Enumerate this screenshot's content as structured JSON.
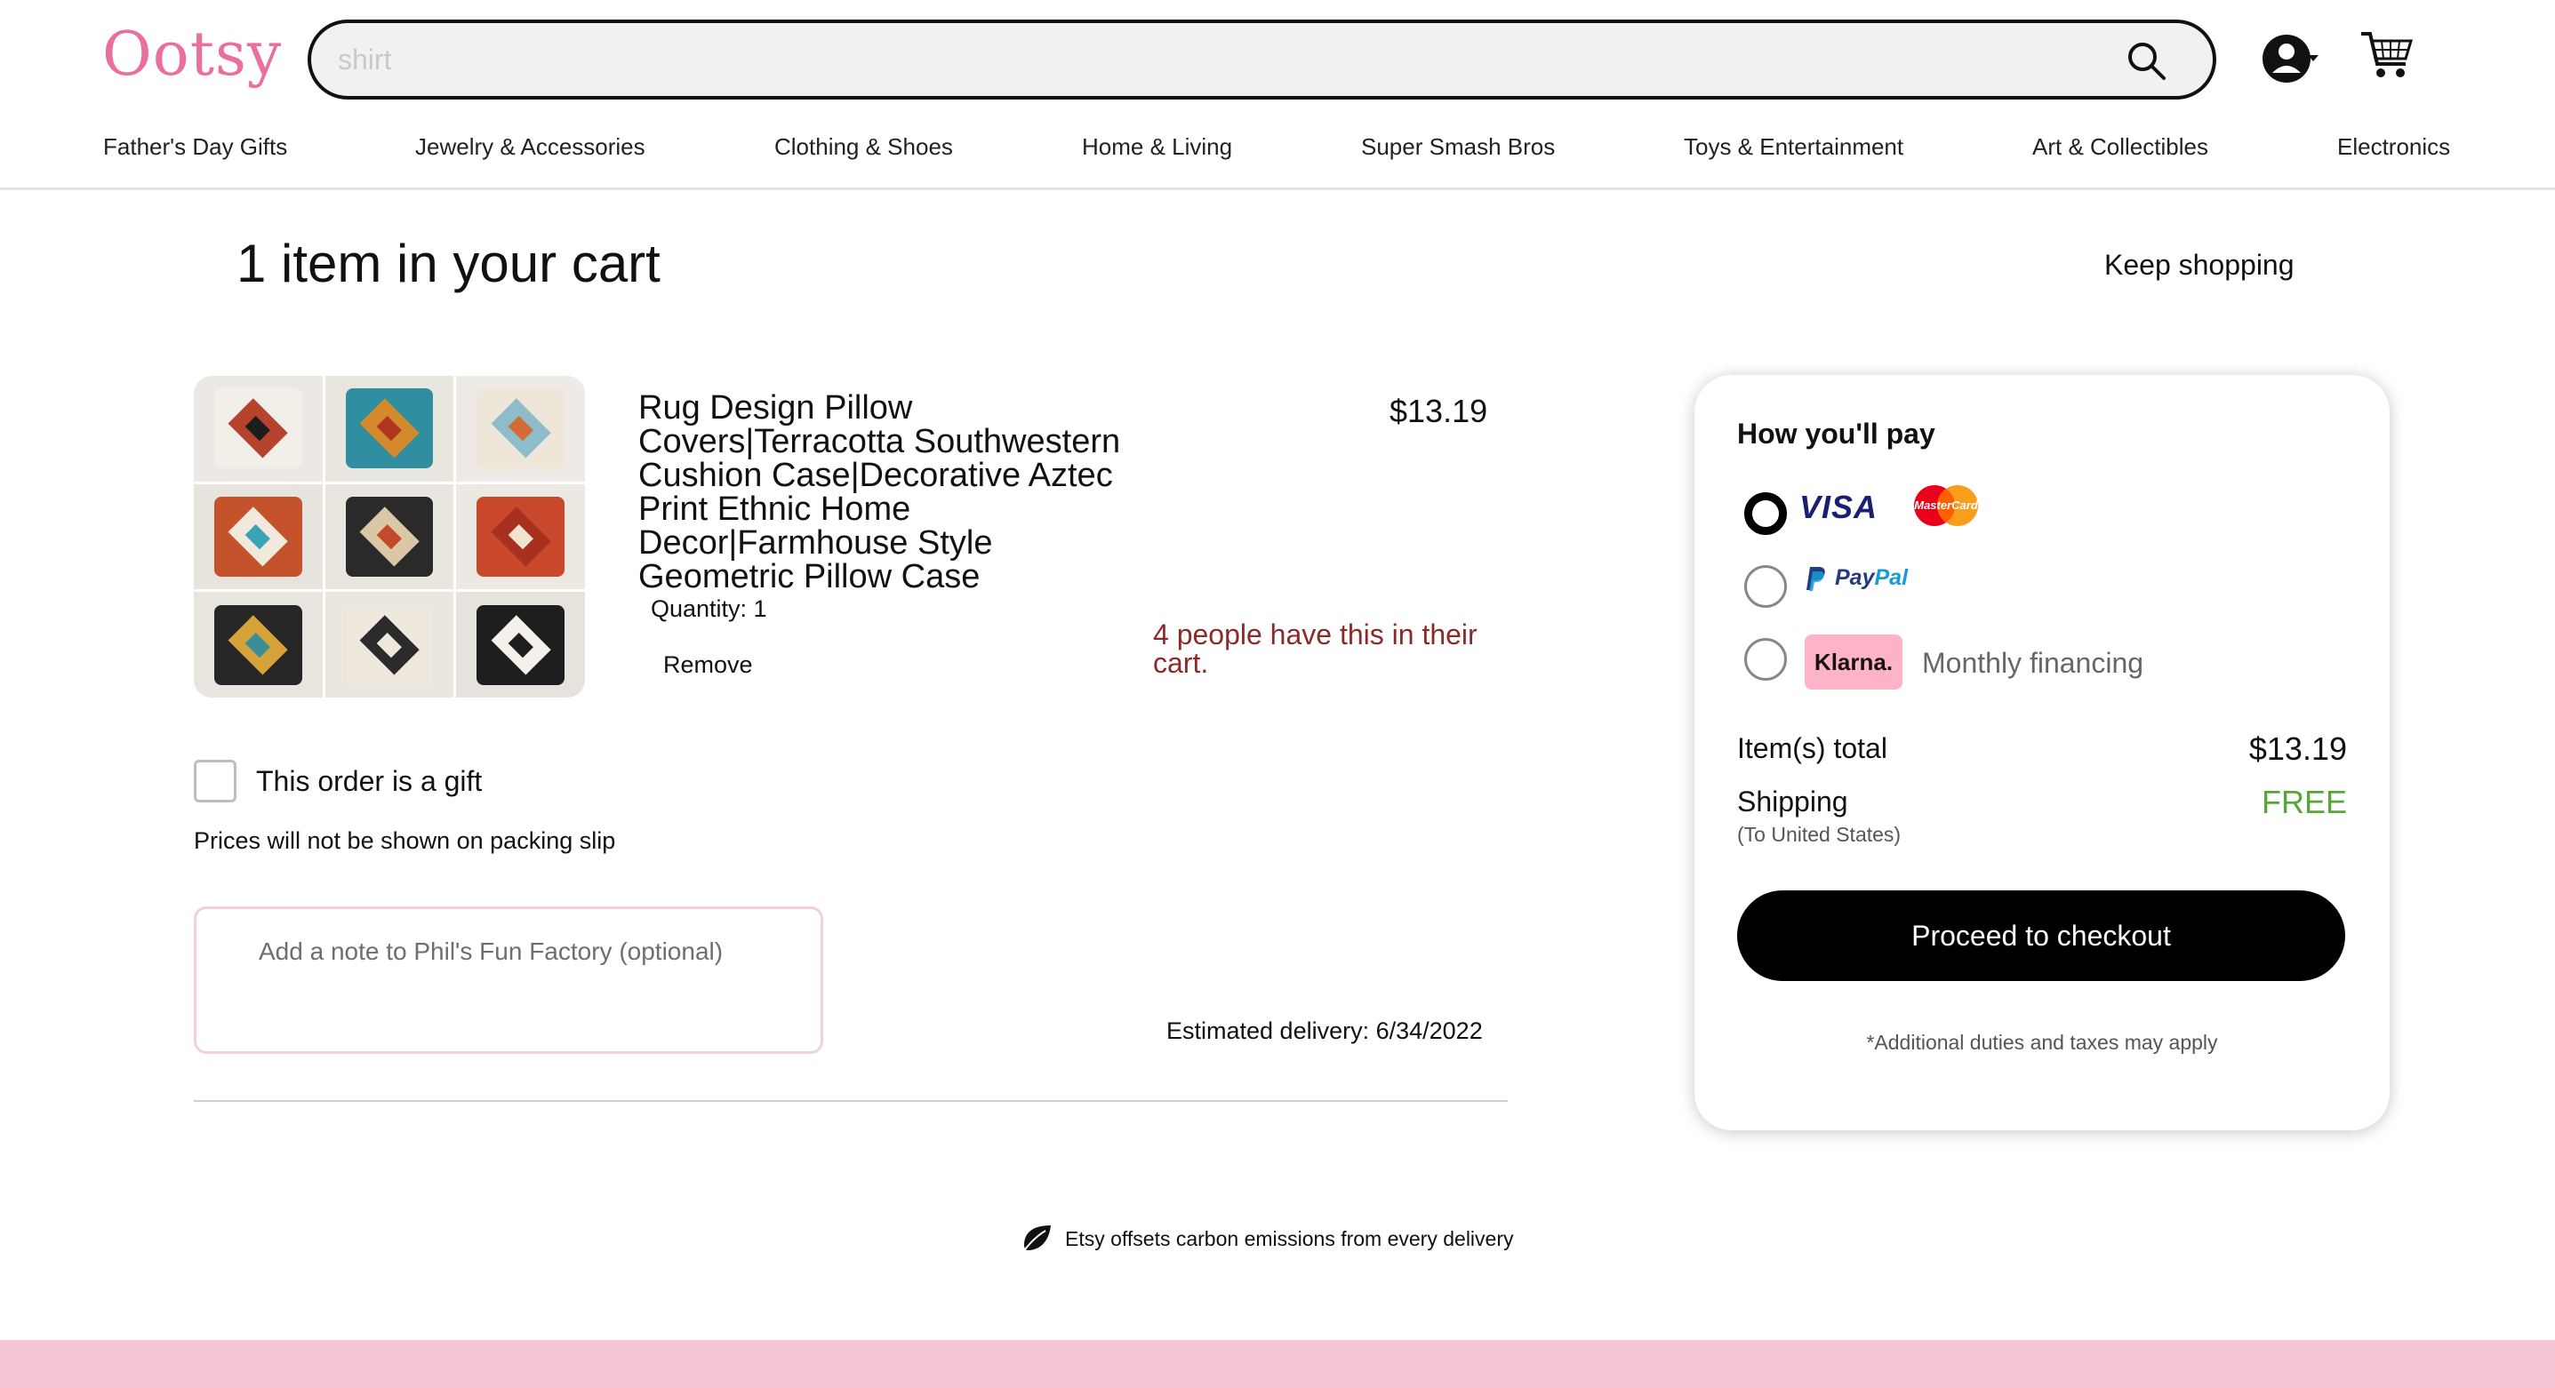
{
  "header": {
    "logo": "Ootsy",
    "search_value": "shirt",
    "nav": [
      "Father's Day Gifts",
      "Jewelry & Accessories",
      "Clothing & Shoes",
      "Home & Living",
      "Super Smash Bros",
      "Toys & Entertainment",
      "Art & Collectibles",
      "Electronics"
    ]
  },
  "cart": {
    "title": "1 item in your cart",
    "keep_shopping": "Keep shopping",
    "item": {
      "title": "Rug Design Pillow Covers|Terracotta Southwestern Cushion Case|Decorative Aztec Print Ethnic Home Decor|Farmhouse Style Geometric Pillow Case",
      "quantity": "Quantity: 1",
      "remove": "Remove",
      "price": "$13.19",
      "demand": "4 people have this in their cart."
    },
    "gift_label": "This order is a gift",
    "gift_note": "Prices will not be shown on packing slip",
    "note_placeholder": "Add a note to Phil's Fun Factory (optional)",
    "delivery": "Estimated delivery: 6/34/2022",
    "carbon": "Etsy offsets carbon emissions from every delivery"
  },
  "payment": {
    "title": "How you'll pay",
    "visa": "VISA",
    "mastercard": "MasterCard",
    "paypal_pay": "Pay",
    "paypal_pal": "Pal",
    "klarna": "Klarna.",
    "klarna_text": "Monthly financing",
    "items_total_label": "Item(s) total",
    "items_total": "$13.19",
    "shipping_label": "Shipping",
    "shipping_sub": "(To United States)",
    "shipping_value": "FREE",
    "checkout": "Proceed to checkout",
    "duties": "*Additional duties and taxes may apply"
  },
  "colors": {
    "brand": "#ea6f9c",
    "footer": "#f6c6d4",
    "free": "#5aa53a",
    "demand": "#8b2a2a"
  }
}
